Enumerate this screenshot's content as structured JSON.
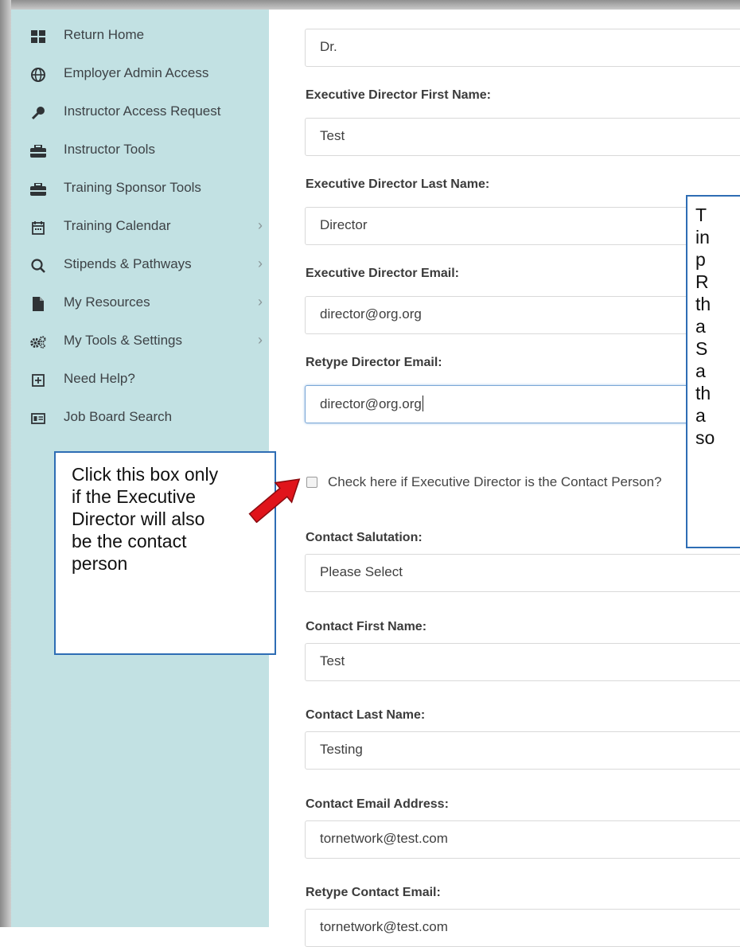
{
  "sidebar": {
    "items": [
      {
        "label": "Return Home",
        "icon": "grid-icon",
        "has_chevron": false
      },
      {
        "label": "Employer Admin Access",
        "icon": "globe-icon",
        "has_chevron": false
      },
      {
        "label": "Instructor Access Request",
        "icon": "key-icon",
        "has_chevron": false
      },
      {
        "label": "Instructor Tools",
        "icon": "toolbox-icon",
        "has_chevron": false
      },
      {
        "label": "Training Sponsor Tools",
        "icon": "toolbox-icon",
        "has_chevron": false
      },
      {
        "label": "Training Calendar",
        "icon": "calendar-icon",
        "has_chevron": true
      },
      {
        "label": "Stipends & Pathways",
        "icon": "search-icon",
        "has_chevron": true
      },
      {
        "label": "My Resources",
        "icon": "file-icon",
        "has_chevron": true
      },
      {
        "label": "My Tools & Settings",
        "icon": "cogs-icon",
        "has_chevron": true
      },
      {
        "label": "Need Help?",
        "icon": "plus-square-icon",
        "has_chevron": false
      },
      {
        "label": "Job Board Search",
        "icon": "id-card-icon",
        "has_chevron": false
      }
    ],
    "chevron": "›"
  },
  "form": {
    "salutation_value": "Dr.",
    "exec_first_name_label": "Executive Director First Name:",
    "exec_first_name_value": "Test",
    "exec_last_name_label": "Executive Director Last Name:",
    "exec_last_name_value": "Director",
    "exec_email_label": "Executive Director Email:",
    "exec_email_value": "director@org.org",
    "retype_director_email_label": "Retype Director Email:",
    "retype_director_email_value": "director@org.org",
    "checkbox_label": "Check here if Executive Director is the Contact Person?",
    "checkbox_checked": false,
    "contact_salutation_label": "Contact Salutation:",
    "contact_salutation_value": "Please Select",
    "contact_first_name_label": "Contact First Name:",
    "contact_first_name_value": "Test",
    "contact_last_name_label": "Contact Last Name:",
    "contact_last_name_value": "Testing",
    "contact_email_label": "Contact Email Address:",
    "contact_email_value": "tornetwork@test.com",
    "retype_contact_email_label": "Retype Contact Email:",
    "retype_contact_email_value": "tornetwork@test.com"
  },
  "callouts": {
    "left_lines": [
      "Click this box only",
      "if the Executive",
      "Director will also",
      "be the contact",
      "person"
    ],
    "right_lines": [
      "T",
      "in",
      "p",
      "R",
      "th",
      "a",
      "S",
      "a",
      "th",
      "a",
      "so"
    ]
  },
  "colors": {
    "sidebar_bg": "#c2e1e3",
    "callout_border": "#2e6db4",
    "arrow_red": "#e0141b"
  }
}
